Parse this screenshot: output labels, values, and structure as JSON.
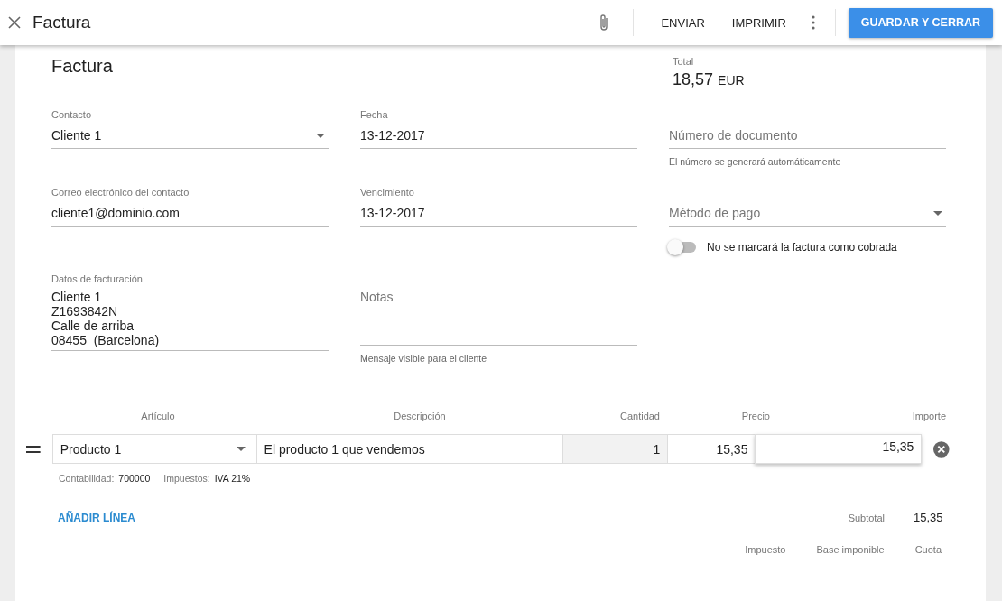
{
  "header": {
    "title": "Factura",
    "actions": [
      "ENVIAR",
      "IMPRIMIR"
    ],
    "primary": "GUARDAR Y CERRAR"
  },
  "heading": "Factura",
  "total": {
    "label": "Total",
    "amount": "18,57",
    "currency": "EUR"
  },
  "fields": [
    {
      "kind": "select",
      "label": "Contacto",
      "value": "Cliente 1"
    },
    {
      "kind": "text",
      "label": "Fecha",
      "value": "13-12-2017"
    },
    {
      "kind": "text",
      "placeholder": "Número de documento",
      "hint": "El número se generará automáticamente"
    },
    {
      "kind": "text",
      "label": "Correo electrónico del contacto",
      "value": "cliente1@dominio.com"
    },
    {
      "kind": "text",
      "label": "Vencimiento",
      "value": "13-12-2017"
    },
    {
      "kind": "select",
      "placeholder": "Método de pago"
    }
  ],
  "toggle": {
    "label": "No se marcará la factura como cobrada",
    "on": false
  },
  "billing": {
    "label": "Datos de facturación",
    "lines": [
      "Cliente 1",
      "Z1693842N",
      "Calle de arriba",
      "08455  (Barcelona)"
    ]
  },
  "notes": {
    "placeholder": "Notas",
    "hint": "Mensaje visible para el cliente"
  },
  "lines_table": {
    "columns": [
      "Artículo",
      "Descripción",
      "Cantidad",
      "Precio",
      "Importe"
    ],
    "rows": [
      {
        "article": "Producto 1",
        "description": "El producto 1 que vendemos",
        "quantity": "1",
        "price": "15,35",
        "amount": "15,35",
        "meta": [
          {
            "label": "Contabilidad:",
            "value": "700000"
          },
          {
            "label": "Impuestos:",
            "value": "IVA 21%"
          }
        ]
      }
    ]
  },
  "add_line": "AÑADIR LÍNEA",
  "subtotal": {
    "label": "Subtotal",
    "value": "15,35"
  },
  "tax_columns": [
    "Impuesto",
    "Base imponible",
    "Cuota"
  ]
}
